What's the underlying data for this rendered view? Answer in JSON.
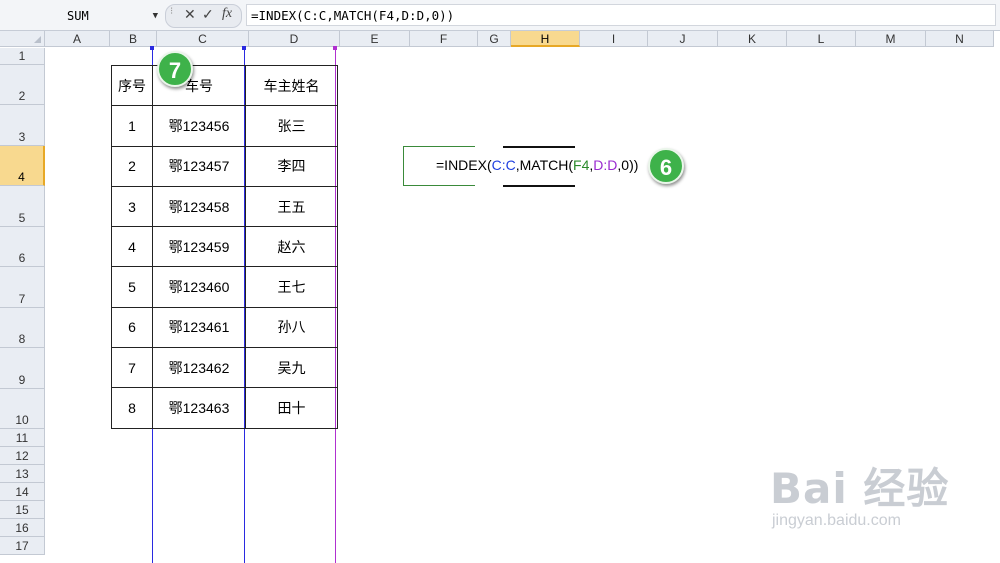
{
  "formula_bar": {
    "name_box": "SUM",
    "name_box_arrow": "▼",
    "cancel_symbol": "✕",
    "enter_symbol": "✓",
    "fx_symbol": "fx",
    "formula": "=INDEX(C:C,MATCH(F4,D:D,0))"
  },
  "columns": [
    "A",
    "B",
    "C",
    "D",
    "E",
    "F",
    "G",
    "H",
    "I",
    "J",
    "K",
    "L",
    "M",
    "N"
  ],
  "rows": [
    "1",
    "2",
    "3",
    "4",
    "5",
    "6",
    "7",
    "8",
    "9",
    "10",
    "11",
    "12",
    "13",
    "14",
    "15",
    "16",
    "17"
  ],
  "selected_column": "H",
  "selected_row": "4",
  "table": {
    "headers": [
      "序号",
      "车号",
      "车主姓名"
    ],
    "rows": [
      [
        "1",
        "鄂123456",
        "张三"
      ],
      [
        "2",
        "鄂123457",
        "李四"
      ],
      [
        "3",
        "鄂123458",
        "王五"
      ],
      [
        "4",
        "鄂123459",
        "赵六"
      ],
      [
        "5",
        "鄂123460",
        "王七"
      ],
      [
        "6",
        "鄂123461",
        "孙八"
      ],
      [
        "7",
        "鄂123462",
        "吴九"
      ],
      [
        "8",
        "鄂123463",
        "田十"
      ]
    ]
  },
  "cell_formula": {
    "prefix": "=INDEX(",
    "ref1": "C:C",
    "mid": ",MATCH(",
    "ref2": "F4",
    "sep": ",",
    "ref3": "D:D",
    "suffix": ",0))"
  },
  "badges": {
    "step_a": "7",
    "step_b": "6"
  },
  "watermark": {
    "logo": "Bai 经验",
    "url": "jingyan.baidu.com"
  },
  "colors": {
    "blue": "#1f3fe0",
    "green": "#2a8a2a",
    "purple": "#9a2ad0",
    "badge": "#3eb24a",
    "selected_header": "#f8d98f"
  }
}
